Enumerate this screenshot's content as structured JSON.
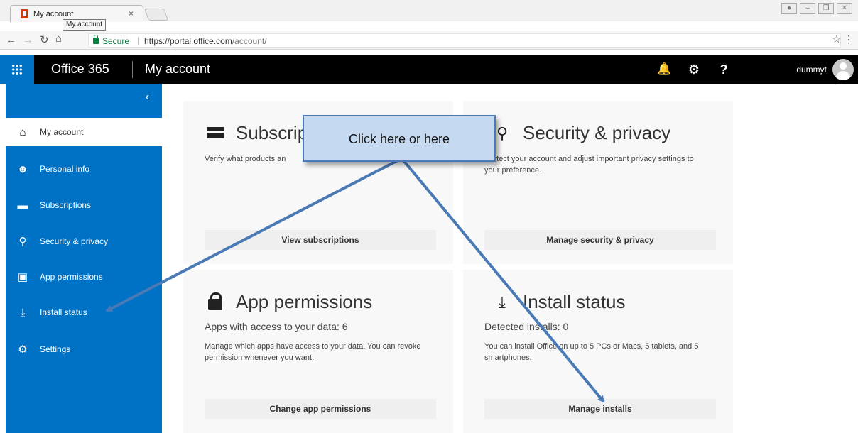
{
  "browser": {
    "tab_title": "My account",
    "tab_tooltip": "My account",
    "close_glyph": "×",
    "secure_label": "Secure",
    "url_host": "https://portal.office.com",
    "url_path": "/account/"
  },
  "header": {
    "brand": "Office 365",
    "page_title": "My account",
    "user_name": "dummyt"
  },
  "sidebar": {
    "collapse_glyph": "‹",
    "items": [
      {
        "label": "My account",
        "icon": "home-icon"
      },
      {
        "label": "Personal info",
        "icon": "person-icon"
      },
      {
        "label": "Subscriptions",
        "icon": "card-icon"
      },
      {
        "label": "Security & privacy",
        "icon": "key-icon"
      },
      {
        "label": "App permissions",
        "icon": "lock-icon"
      },
      {
        "label": "Install status",
        "icon": "download-icon"
      },
      {
        "label": "Settings",
        "icon": "gear-icon"
      }
    ],
    "active_index": 0
  },
  "cards": {
    "subscriptions": {
      "title": "Subscrip",
      "desc": "Verify what products an",
      "button": "View subscriptions"
    },
    "security": {
      "title": "Security & privacy",
      "desc": "Protect your account and adjust important privacy settings to your preference.",
      "button": "Manage security & privacy"
    },
    "app_permissions": {
      "title": "App permissions",
      "subtitle": "Apps with access to your data: 6",
      "desc": "Manage which apps have access to your data. You can revoke permission whenever you want.",
      "button": "Change app permissions"
    },
    "install_status": {
      "title": "Install status",
      "subtitle": "Detected installs: 0",
      "desc": "You can install Office on up to 5 PCs or Macs, 5 tablets, and 5 smartphones.",
      "button": "Manage installs"
    }
  },
  "callout": {
    "text": "Click here or here"
  },
  "colors": {
    "accent": "#0072c6",
    "callout_fill": "#c5d9f1",
    "arrow": "#4a7ab5"
  }
}
